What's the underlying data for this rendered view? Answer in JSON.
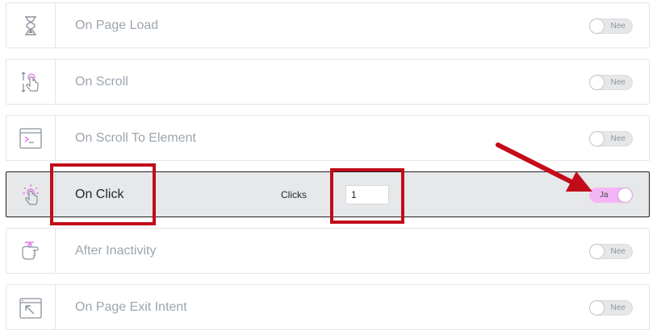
{
  "triggers": [
    {
      "label": "On Page Load",
      "icon": "hourglass-icon",
      "toggle": "Nee",
      "enabled": false
    },
    {
      "label": "On Scroll",
      "icon": "scroll-touch-icon",
      "toggle": "Nee",
      "enabled": false
    },
    {
      "label": "On Scroll To Element",
      "icon": "element-window-icon",
      "toggle": "Nee",
      "enabled": false
    },
    {
      "label": "On Click",
      "icon": "click-tap-icon",
      "toggle": "Ja",
      "enabled": true,
      "clicks_label": "Clicks",
      "clicks_value": "1"
    },
    {
      "label": "After Inactivity",
      "icon": "inactivity-hand-icon",
      "toggle": "Nee",
      "enabled": false
    },
    {
      "label": "On Page Exit Intent",
      "icon": "exit-intent-icon",
      "toggle": "Nee",
      "enabled": false
    }
  ],
  "colors": {
    "accent": "#f4b5f6",
    "icon_pink": "#e36bea",
    "annotation_red": "#c20c1a",
    "active_row_bg": "#e7e8ea"
  }
}
